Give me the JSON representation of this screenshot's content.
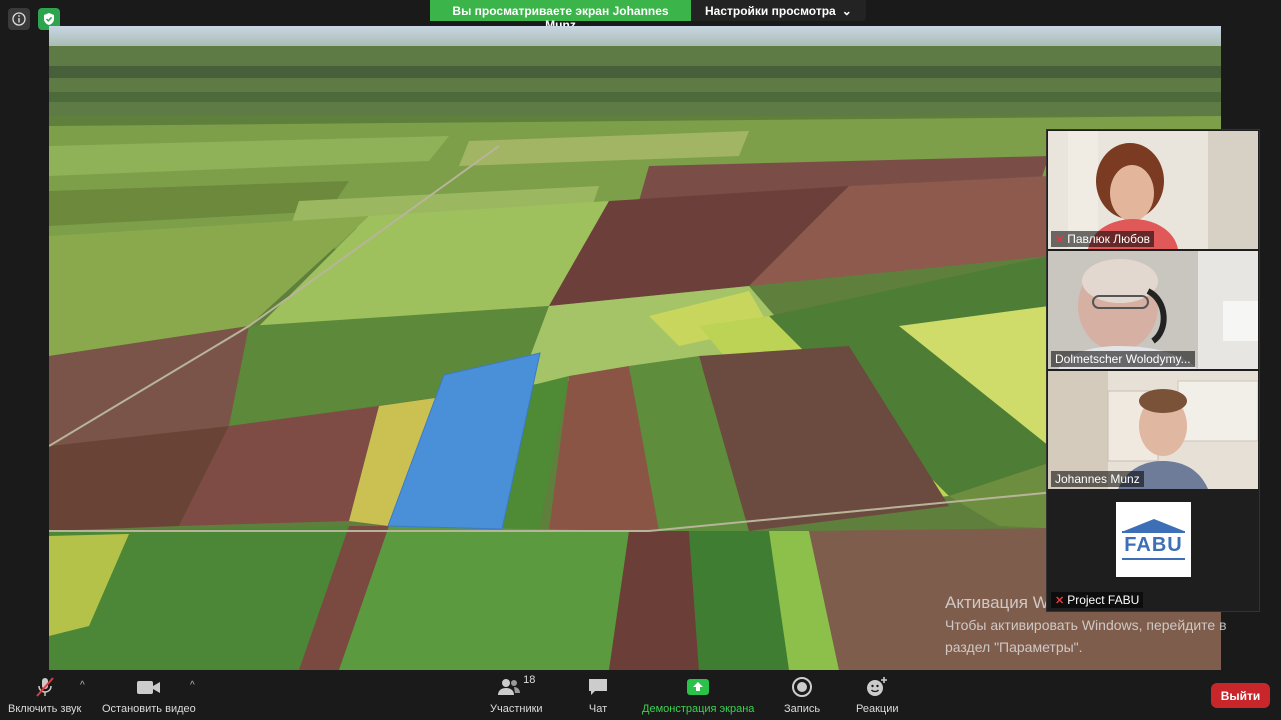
{
  "share_banner": {
    "status": "Вы просматриваете экран Johannes Munz",
    "settings_label": "Настройки просмотра"
  },
  "participants": [
    {
      "name": "Павлюк Любов",
      "muted": true
    },
    {
      "name": "Dolmetscher Wolodymy...",
      "muted": false,
      "active": true
    },
    {
      "name": "Johannes Munz",
      "muted": false
    },
    {
      "name": "Project FABU",
      "muted": true,
      "logo_text": "FABU"
    }
  ],
  "watermark": {
    "title": "Активация Windows",
    "line1": "Чтобы активировать Windows, перейдите в",
    "line2": "раздел \"Параметры\"."
  },
  "toolbar": {
    "unmute_label": "Включить звук",
    "stop_video_label": "Остановить видео",
    "participants_label": "Участники",
    "participants_count": "18",
    "chat_label": "Чат",
    "share_label": "Демонстрация экрана",
    "record_label": "Запись",
    "reactions_label": "Реакции",
    "leave_label": "Выйти"
  },
  "colors": {
    "share_green": "#3bb54a",
    "leave_red": "#c8262b",
    "highlight_field": "#4a90d9"
  }
}
